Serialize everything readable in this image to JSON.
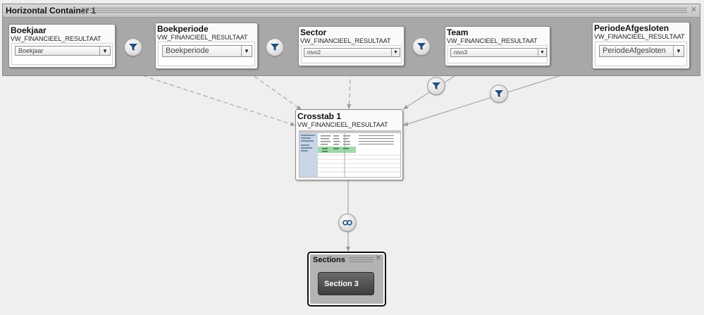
{
  "container": {
    "title": "Horizontal Container 1",
    "close": "✕"
  },
  "filters": [
    {
      "title": "Boekjaar",
      "source": "VW_FINANCIEEL_RESULTAAT",
      "value": "Boekjaar"
    },
    {
      "title": "Boekperiode",
      "source": "VW_FINANCIEEL_RESULTAAT",
      "value": "Boekperiode"
    },
    {
      "title": "Sector",
      "source": "VW_FINANCIEEL_RESULTAAT",
      "value": "nivo2"
    },
    {
      "title": "Team",
      "source": "VW_FINANCIEEL_RESULTAAT",
      "value": "nivo3"
    },
    {
      "title": "PeriodeAfgesloten",
      "source": "VW_FINANCIEEL_RESULTAAT",
      "value": "PeriodeAfgesloten"
    }
  ],
  "dropdown_arrow": "▼",
  "crosstab": {
    "title": "Crosstab 1",
    "source": "VW_FINANCIEEL_RESULTAAT"
  },
  "sections": {
    "title": "Sections",
    "close": "✕",
    "item": "Section 3"
  },
  "icons": {
    "filter": "filter-icon",
    "link": "link-icon"
  },
  "colors": {
    "canvas": "#efefef",
    "container": "#a8a8a8",
    "section_button": "#4f4f4f",
    "thumb_highlight": "#9fd9a8"
  }
}
